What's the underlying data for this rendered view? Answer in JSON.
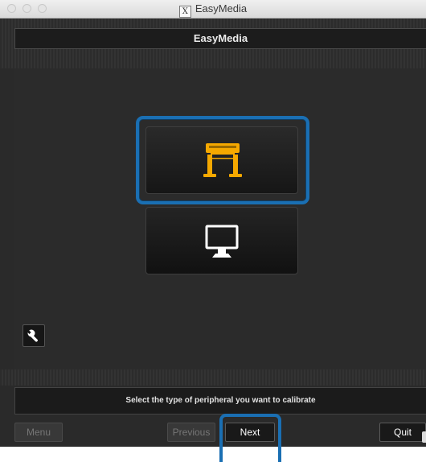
{
  "window": {
    "title": "EasyMedia",
    "app_icon_glyph": "X"
  },
  "header": {
    "title": "EasyMedia"
  },
  "peripherals": [
    {
      "id": "printer",
      "icon": "printer-icon",
      "icon_color": "#f5a800",
      "selected": true
    },
    {
      "id": "display",
      "icon": "monitor-icon",
      "icon_color": "#ffffff",
      "selected": false
    }
  ],
  "tools": {
    "icon": "wrench-icon"
  },
  "status": {
    "message": "Select the type of peripheral you want to calibrate"
  },
  "buttons": {
    "menu": "Menu",
    "previous": "Previous",
    "next": "Next",
    "quit": "Quit"
  },
  "colors": {
    "highlight": "#1a6fb3",
    "printer_accent": "#f5a800",
    "background": "#2a2a2a"
  }
}
